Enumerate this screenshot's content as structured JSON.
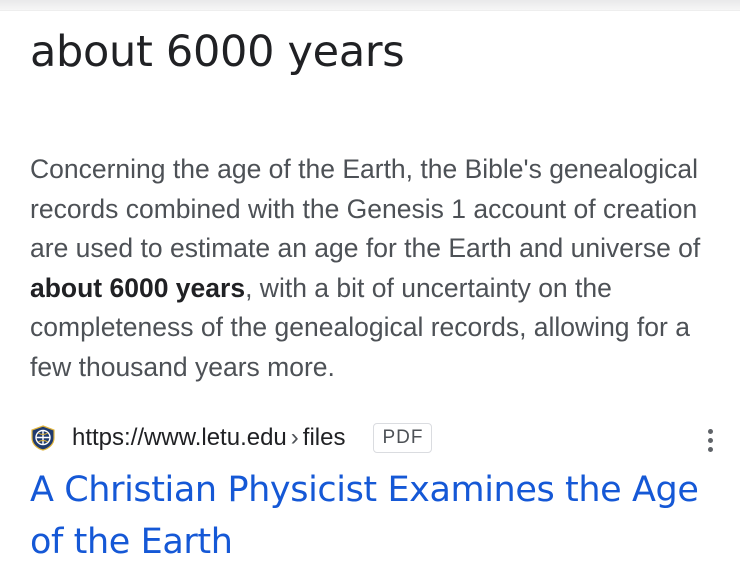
{
  "answer": {
    "text": "about 6000 years"
  },
  "snippet": {
    "before": "Concerning the age of the Earth, the Bible's genealogical records combined with the Genesis 1 account of creation are used to estimate an age for the Earth and universe of ",
    "highlight": "about 6000 years",
    "after": ", with a bit of uncertainty on the completeness of the genealogical records, allowing for a few thousand years more."
  },
  "source": {
    "favicon": "letu-shield-icon",
    "url": "https://www.letu.edu",
    "separator": "›",
    "path": "files",
    "badge": "PDF",
    "more_icon": "more-vert-icon"
  },
  "result": {
    "title": "A Christian Physicist Examines the Age of the Earth"
  },
  "colors": {
    "link": "#1558d6",
    "text": "#202124",
    "snippet": "#4d5156",
    "favicon_navy": "#1f3a6e",
    "favicon_gold": "#e0b43c"
  }
}
